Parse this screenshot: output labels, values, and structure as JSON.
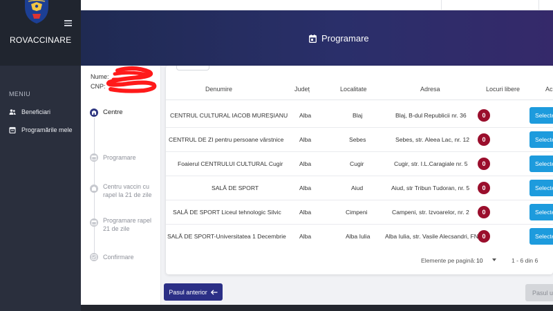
{
  "sidebar": {
    "brand": "ROVACCINARE",
    "menu_title": "MENIU",
    "items": [
      {
        "label": "Beneficiari",
        "icon": "users-icon"
      },
      {
        "label": "Programările mele",
        "icon": "calendar-icon"
      }
    ]
  },
  "header": {
    "title": "Programare",
    "icon": "calendar-icon"
  },
  "person": {
    "name_label": "Nume:",
    "cnp_label": "CNP:"
  },
  "steps": [
    {
      "label": "Centre",
      "state": "active"
    },
    {
      "label": "Programare",
      "state": "todo"
    },
    {
      "label": "Centru vaccin cu rapel la 21 de zile",
      "state": "todo"
    },
    {
      "label": "Programare rapel 21 de zile",
      "state": "todo"
    },
    {
      "label": "Confirmare",
      "state": "todo"
    }
  ],
  "table": {
    "columns": [
      "Denumire",
      "Județ",
      "Localitate",
      "Adresa",
      "Locuri libere",
      "Ac"
    ],
    "rows": [
      {
        "denumire": "CENTRUL CULTURAL IACOB MUREȘIANU",
        "judet": "Alba",
        "localitate": "Blaj",
        "adresa": "Blaj, B-dul Republicii nr. 36",
        "locuri": "0",
        "action": "Selecte"
      },
      {
        "denumire": "CENTRUL DE ZI pentru persoane vârstnice",
        "judet": "Alba",
        "localitate": "Sebes",
        "adresa": "Sebes, str. Aleea Lac, nr. 12",
        "locuri": "0",
        "action": "Selecte"
      },
      {
        "denumire": "Foaierul CENTRULUI CULTURAL Cugir",
        "judet": "Alba",
        "localitate": "Cugir",
        "adresa": "Cugir, str. I.L.Caragiale nr. 5",
        "locuri": "0",
        "action": "Selecte"
      },
      {
        "denumire": "SALĂ DE SPORT",
        "judet": "Alba",
        "localitate": "Aiud",
        "adresa": "Aiud, str Tribun Tudoran, nr. 5",
        "locuri": "0",
        "action": "Selecte"
      },
      {
        "denumire": "SALĂ DE SPORT Liceul tehnologic Silvic",
        "judet": "Alba",
        "localitate": "Cimpeni",
        "adresa": "Campeni, str. Izvoarelor, nr. 2",
        "locuri": "0",
        "action": "Selecte"
      },
      {
        "denumire": "SALĂ DE SPORT-Universitatea 1 Decembrie",
        "judet": "Alba",
        "localitate": "Alba Iulia",
        "adresa": "Alba Iulia, str. Vasile Alecsandri, FN",
        "locuri": "0",
        "action": "Selecte"
      }
    ]
  },
  "pagination": {
    "per_page_label": "Elemente pe pagină:",
    "per_page_value": "10",
    "range": "1 - 6 din 6"
  },
  "buttons": {
    "prev": "Pasul anterior",
    "next": "Pasul ur"
  },
  "colors": {
    "accent": "#2b2f86",
    "select": "#1d9bdd",
    "badge": "#9a0e2c"
  }
}
